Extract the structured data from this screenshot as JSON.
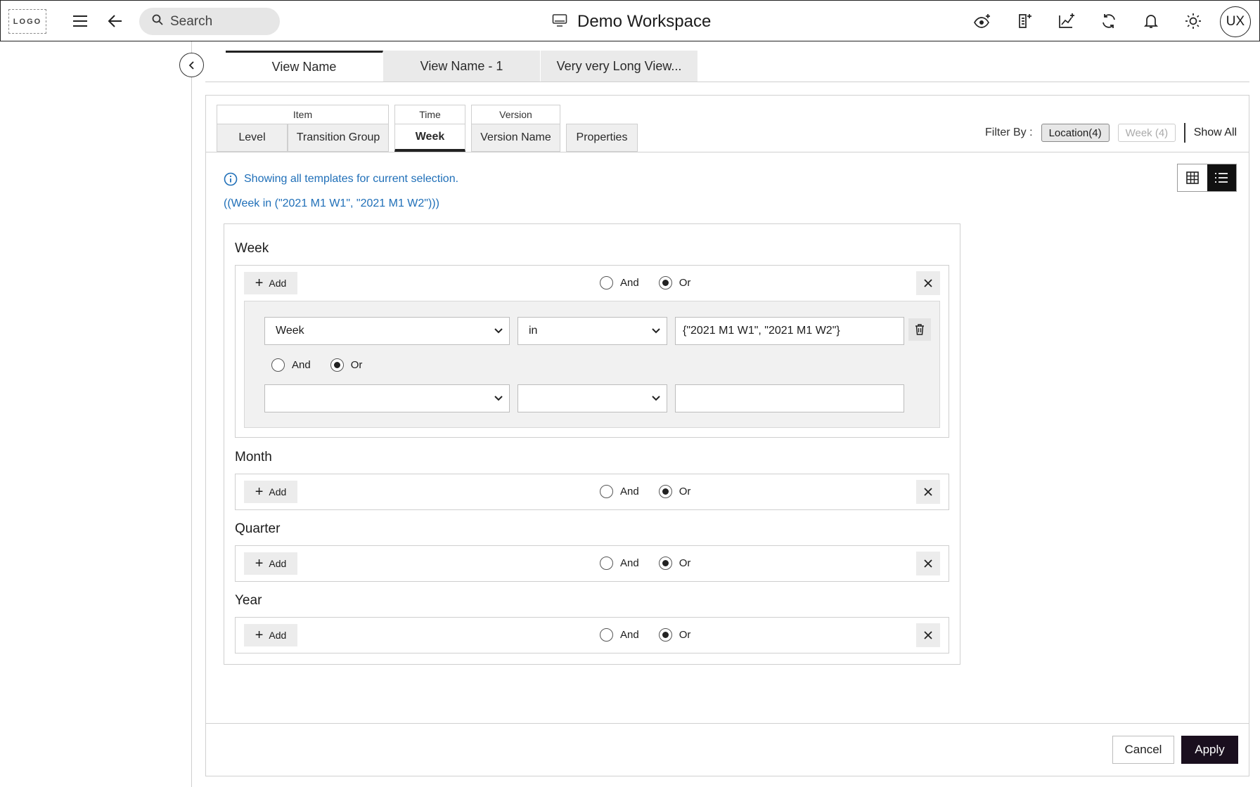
{
  "header": {
    "logo": "LOGO",
    "search_placeholder": "Search",
    "title": "Demo Workspace",
    "avatar": "UX",
    "icons": [
      "menu-icon",
      "back-arrow-icon",
      "search-icon",
      "monitor-icon",
      "eye-plus-icon",
      "document-plus-icon",
      "chart-plus-icon",
      "refresh-icon",
      "bell-icon",
      "sun-icon"
    ]
  },
  "view_tabs": [
    {
      "label": "View Name",
      "active": true
    },
    {
      "label": "View Name - 1",
      "active": false
    },
    {
      "label": "Very very Long View...",
      "active": false
    }
  ],
  "dimensions": {
    "item": {
      "label": "Item",
      "tabs": [
        "Level",
        "Transition Group"
      ]
    },
    "time": {
      "label": "Time",
      "tabs": [
        "Week"
      ]
    },
    "version": {
      "label": "Version",
      "tabs": [
        "Version Name"
      ]
    },
    "properties": "Properties",
    "active_tab": "Week"
  },
  "filter_by": {
    "label": "Filter By :",
    "chips": [
      {
        "label": "Location(4)",
        "enabled": true
      },
      {
        "label": "Week (4)",
        "enabled": false
      }
    ],
    "show_all": "Show All"
  },
  "info": {
    "message": "Showing all templates for current selection.",
    "expression": "((Week in (\"2021 M1 W1\", \"2021 M1 W2\")))"
  },
  "sections": [
    {
      "title": "Week",
      "add_label": "Add",
      "and_label": "And",
      "or_label": "Or",
      "selected": "Or"
    },
    {
      "title": "Month",
      "add_label": "Add",
      "and_label": "And",
      "or_label": "Or",
      "selected": "Or"
    },
    {
      "title": "Quarter",
      "add_label": "Add",
      "and_label": "And",
      "or_label": "Or",
      "selected": "Or"
    },
    {
      "title": "Year",
      "add_label": "Add",
      "and_label": "And",
      "or_label": "Or",
      "selected": "Or"
    }
  ],
  "week_condition": {
    "field": "Week",
    "operator": "in",
    "value": "{\"2021 M1 W1\", \"2021 M1 W2\"}",
    "and_label": "And",
    "or_label": "Or",
    "selected": "Or",
    "row2_field": "",
    "row2_operator": "",
    "row2_value": ""
  },
  "footer": {
    "cancel": "Cancel",
    "apply": "Apply"
  }
}
